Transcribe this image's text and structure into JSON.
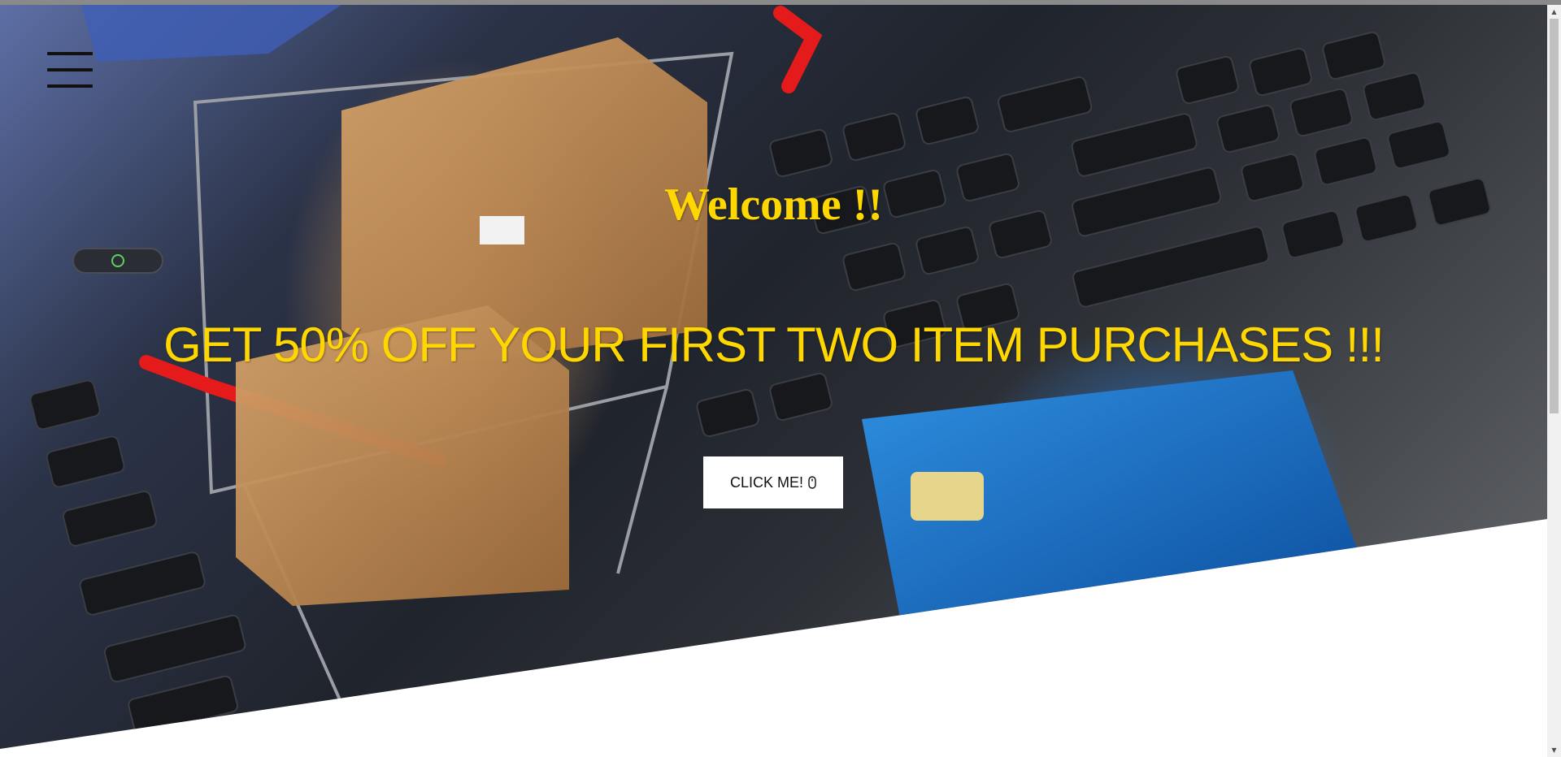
{
  "hero": {
    "background_image": "online-shopping-cart-on-laptop-keyboard-with-credit-card",
    "welcome_text": "Welcome !!",
    "promo_text": "GET 50% OFF YOUR FIRST TWO ITEM PURCHASES !!!",
    "button_label": "CLICK ME!",
    "button_icon": "mouse-icon"
  },
  "nav": {
    "menu_icon": "hamburger-menu-icon"
  },
  "colors": {
    "headline": "#ffd700",
    "button_bg": "#ffffff",
    "button_text": "#111111",
    "menu_icon": "#111111",
    "page_bg": "#ffffff"
  }
}
